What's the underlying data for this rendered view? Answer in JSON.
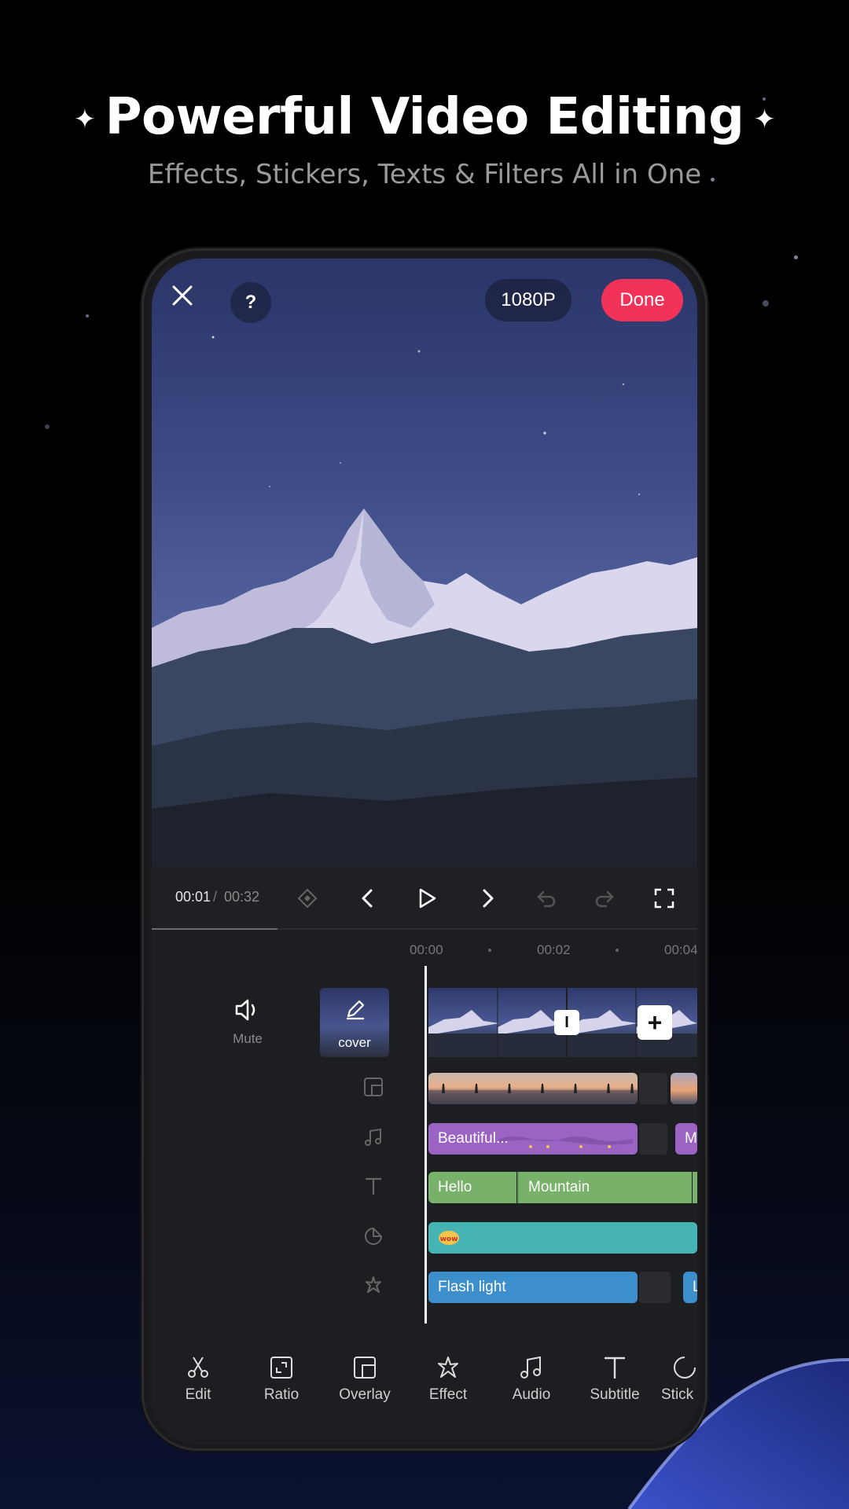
{
  "promo": {
    "title": "Powerful Video Editing",
    "subtitle": "Effects, Stickers, Texts & Filters All in One",
    "sparkle": "✦"
  },
  "editor": {
    "top_bar": {
      "close_icon": "close-icon",
      "help_label": "?",
      "resolution_label": "1080P",
      "done_label": "Done",
      "done_color": "#f3325a"
    },
    "playback": {
      "current_time": "00:01",
      "separator": "/",
      "total_time": "00:32",
      "progress_fraction": 0.23
    },
    "ruler": {
      "ticks": [
        "00:00",
        "00:02",
        "00:04"
      ]
    },
    "main_track": {
      "mute_label": "Mute",
      "cover_label": "cover",
      "split_label": "I",
      "add_label": "+"
    },
    "tracks": {
      "audio_clip_1": "Beautiful...",
      "audio_clip_2": "M",
      "text_clip_1": "Hello",
      "text_clip_2": "Mountain",
      "effect_clip_1": "Flash light",
      "effect_clip_2": "L",
      "colors": {
        "audio": "#9b63c4",
        "text": "#78b169",
        "sticker": "#46b3b5",
        "effect": "#3d8fcc"
      }
    },
    "toolbar": [
      {
        "label": "Edit",
        "icon": "scissors-icon"
      },
      {
        "label": "Ratio",
        "icon": "ratio-icon"
      },
      {
        "label": "Overlay",
        "icon": "overlay-icon"
      },
      {
        "label": "Effect",
        "icon": "effect-icon"
      },
      {
        "label": "Audio",
        "icon": "music-icon"
      },
      {
        "label": "Subtitle",
        "icon": "text-icon"
      },
      {
        "label": "Stick",
        "icon": "sticker-icon"
      }
    ]
  }
}
